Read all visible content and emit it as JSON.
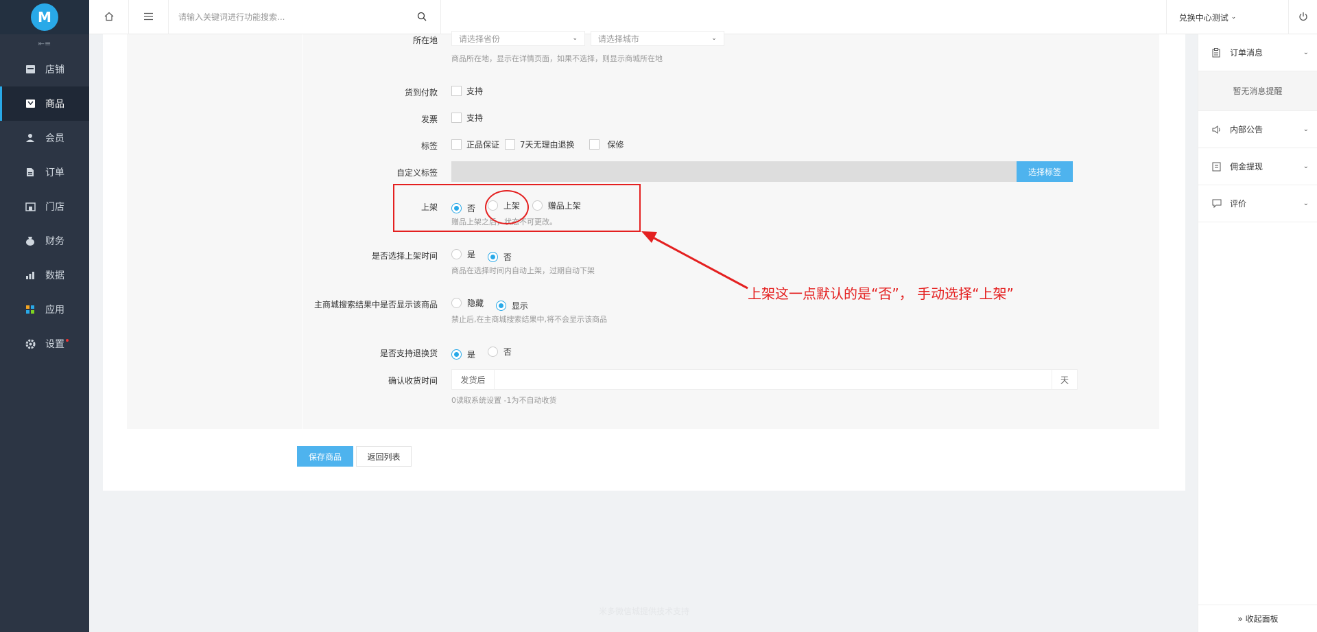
{
  "sidebar": {
    "logo_text": "M",
    "collapse_glyph": "⇤≡",
    "items": [
      {
        "label": "店铺",
        "icon": "shop-icon"
      },
      {
        "label": "商品",
        "icon": "goods-icon"
      },
      {
        "label": "会员",
        "icon": "member-icon"
      },
      {
        "label": "订单",
        "icon": "order-icon"
      },
      {
        "label": "门店",
        "icon": "store-icon"
      },
      {
        "label": "财务",
        "icon": "finance-icon"
      },
      {
        "label": "数据",
        "icon": "data-icon"
      },
      {
        "label": "应用",
        "icon": "apps-icon"
      },
      {
        "label": "设置",
        "icon": "settings-icon"
      }
    ],
    "active_index": 1
  },
  "header": {
    "search_placeholder": "请输入关键词进行功能搜索...",
    "switch_center_label": "兑换中心测试"
  },
  "form": {
    "location": {
      "label": "所在地",
      "province_placeholder": "请选择省份",
      "city_placeholder": "请选择城市",
      "hint": "商品所在地，显示在详情页面，如果不选择，则显示商城所在地"
    },
    "cod": {
      "label": "货到付款",
      "option": "支持"
    },
    "invoice": {
      "label": "发票",
      "option": "支持"
    },
    "tags": {
      "label": "标签",
      "options": [
        "正品保证",
        "7天无理由退换",
        "保修"
      ]
    },
    "custom_tags": {
      "label": "自定义标签",
      "button": "选择标签"
    },
    "on_shelf": {
      "label": "上架",
      "options": [
        "否",
        "上架",
        "赠品上架"
      ],
      "selected": 0,
      "hint": "赠品上架之后，状态不可更改。"
    },
    "shelf_time": {
      "label": "是否选择上架时间",
      "options": [
        "是",
        "否"
      ],
      "selected": 1,
      "hint": "商品在选择时间内自动上架，过期自动下架"
    },
    "search_display": {
      "label": "主商城搜索结果中是否显示该商品",
      "options": [
        "隐藏",
        "显示"
      ],
      "selected": 1,
      "hint": "禁止后,在主商城搜索结果中,将不会显示该商品"
    },
    "returns": {
      "label": "是否支持退换货",
      "options": [
        "是",
        "否"
      ],
      "selected": 0
    },
    "receive_time": {
      "label": "确认收货时间",
      "prefix": "发货后",
      "suffix": "天",
      "hint": "0读取系统设置 -1为不自动收货"
    }
  },
  "actions": {
    "save": "保存商品",
    "back": "返回列表"
  },
  "footer": {
    "text": "米多微信城提供技术支持"
  },
  "annotation": {
    "text": "上架这一点默认的是“否”， 手动选择“上架”",
    "color": "#e42020"
  },
  "right_panel": {
    "order_msg": "订单消息",
    "no_msg": "暂无消息提醒",
    "notice": "内部公告",
    "commission": "佣金提现",
    "review": "评价",
    "collapse": "» 收起面板"
  }
}
